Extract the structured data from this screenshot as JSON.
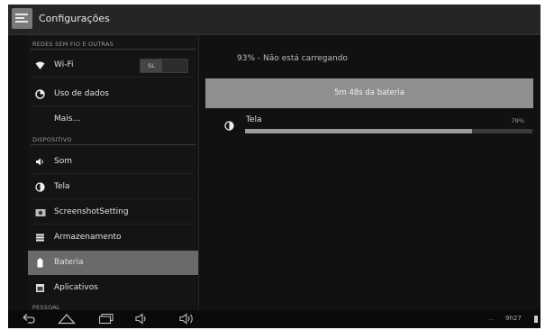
{
  "app": {
    "title": "Configurações"
  },
  "sidebar": {
    "sections": [
      {
        "label": "REDES SEM FIO E OUTRAS"
      },
      {
        "label": "DISPOSITIVO"
      },
      {
        "label": "PESSOAL"
      }
    ],
    "items": [
      {
        "label": "Wi-Fi",
        "icon": "wifi-icon",
        "toggle": "SL"
      },
      {
        "label": "Uso de dados",
        "icon": "data-usage-icon"
      },
      {
        "label": "Mais..."
      },
      {
        "label": "Som",
        "icon": "speaker-icon"
      },
      {
        "label": "Tela",
        "icon": "brightness-icon"
      },
      {
        "label": "ScreenshotSetting",
        "icon": "camera-icon"
      },
      {
        "label": "Armazenamento",
        "icon": "storage-icon"
      },
      {
        "label": "Bateria",
        "icon": "battery-icon",
        "selected": true
      },
      {
        "label": "Aplicativos",
        "icon": "apps-icon"
      }
    ]
  },
  "battery": {
    "status": "93% - Não está carregando",
    "time_on_battery": "5m 48s da bateria",
    "usage": [
      {
        "label": "Tela",
        "percent_label": "79%",
        "fraction": 0.79,
        "icon": "brightness-icon"
      }
    ]
  },
  "navbar": {
    "clock": "9h27",
    "overflow": "...",
    "icons": [
      "back-icon",
      "home-icon",
      "recent-apps-icon",
      "volume-down-icon",
      "volume-up-icon",
      "battery-status-icon"
    ]
  }
}
